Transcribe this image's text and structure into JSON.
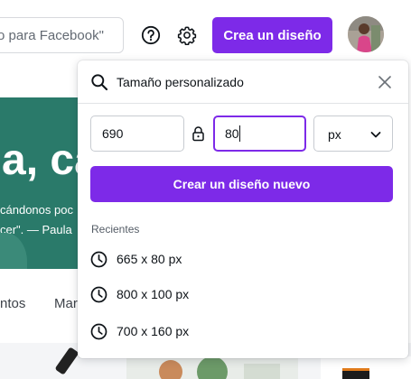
{
  "header": {
    "search_text": "o para Facebook\"",
    "create_button": "Crea un diseño"
  },
  "background": {
    "hero_big": "a, ca",
    "hero_line1": "cándonos poc",
    "hero_line2": "cer\". — Paula",
    "nav_item1": "ntos",
    "nav_item2": "Mar"
  },
  "custom_size": {
    "title": "Tamaño personalizado",
    "width_value": "690",
    "height_value": "80",
    "unit": "px",
    "create_label": "Crear un diseño nuevo",
    "recent_heading": "Recientes",
    "recents": [
      "665 x 80 px",
      "800 x 100 px",
      "700 x 160 px"
    ]
  },
  "colors": {
    "accent": "#7d2ae8",
    "hero_bg": "#2a7a6a"
  }
}
